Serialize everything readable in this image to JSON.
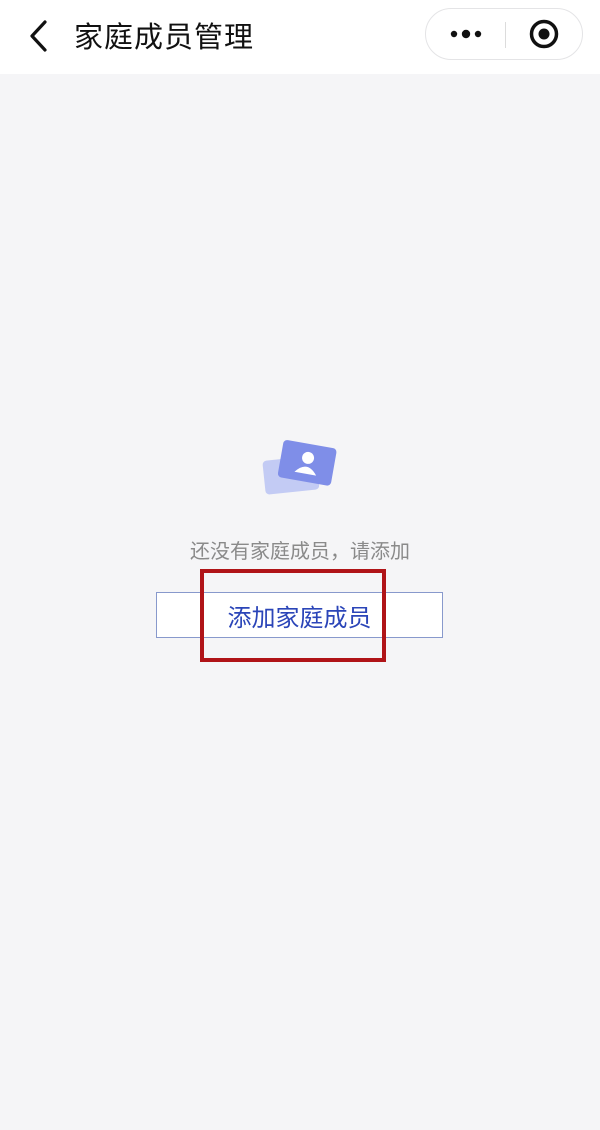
{
  "nav": {
    "title": "家庭成员管理",
    "back_icon": "chevron-left-icon",
    "more_icon": "more-dots-icon",
    "close_icon": "target-close-icon"
  },
  "empty_state": {
    "icon": "member-card-icon",
    "message": "还没有家庭成员，请添加",
    "add_button_label": "添加家庭成员"
  },
  "colors": {
    "accent": "#2b45b8",
    "highlight_box": "#b01418",
    "icon_primary": "#7f8ee8",
    "icon_secondary": "#c3cbf4",
    "background": "#f5f5f7"
  }
}
